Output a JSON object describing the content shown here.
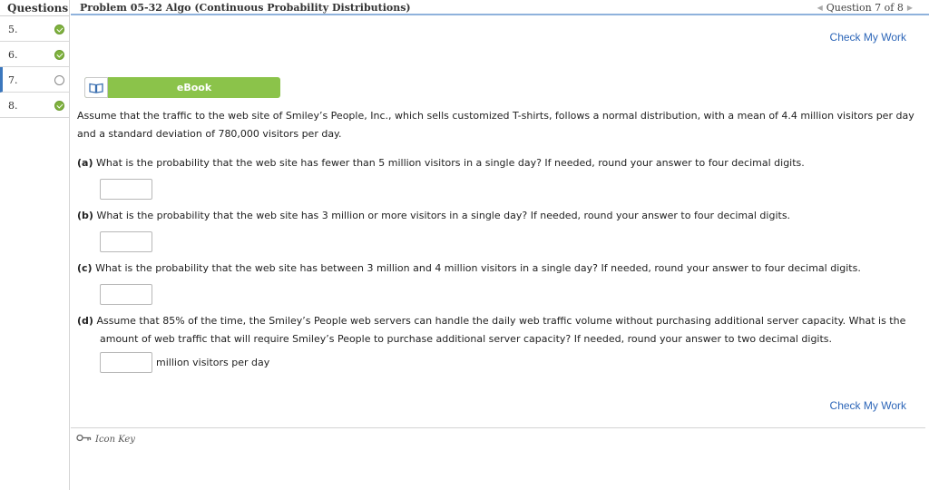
{
  "nav": {
    "header": "Questions",
    "items": [
      {
        "label": "5.",
        "status": "done"
      },
      {
        "label": "6.",
        "status": "done"
      },
      {
        "label": "7.",
        "status": "open"
      },
      {
        "label": "8.",
        "status": "done"
      }
    ]
  },
  "header": {
    "title": "Problem 05-32 Algo (Continuous Probability Distributions)",
    "pager": "Question 7 of 8"
  },
  "check_my_work": "Check My Work",
  "ebook": {
    "label": "eBook",
    "icon": "book-icon"
  },
  "problem": {
    "intro": "Assume that the traffic to the web site of Smiley’s People, Inc., which sells customized T-shirts, follows a normal distribution, with a mean of 4.4 million visitors per day and a standard deviation of 780,000 visitors per day.",
    "parts": [
      {
        "tag": "(a)",
        "text": "What is the probability that the web site has fewer than 5 million visitors in a single day? If needed, round your answer to four decimal digits.",
        "value": "",
        "unit": ""
      },
      {
        "tag": "(b)",
        "text": "What is the probability that the web site has 3 million or more visitors in a single day? If needed, round your answer to four decimal digits.",
        "value": "",
        "unit": ""
      },
      {
        "tag": "(c)",
        "text": "What is the probability that the web site has between 3 million and 4 million visitors in a single day? If needed, round your answer to four decimal digits.",
        "value": "",
        "unit": ""
      },
      {
        "tag": "(d)",
        "text": "Assume that 85% of the time, the Smiley’s People web servers can handle the daily web traffic volume without purchasing additional server capacity. What is the amount of web traffic that will require Smiley’s People to purchase additional server capacity? If needed, round your answer to two decimal digits.",
        "value": "",
        "unit": "million visitors per day"
      }
    ]
  },
  "icon_key": "Icon Key",
  "colors": {
    "accent": "#2d66b8",
    "ebook_green": "#8bc34a",
    "done_green": "#7fb23e",
    "header_rule": "#8fb2dc"
  }
}
